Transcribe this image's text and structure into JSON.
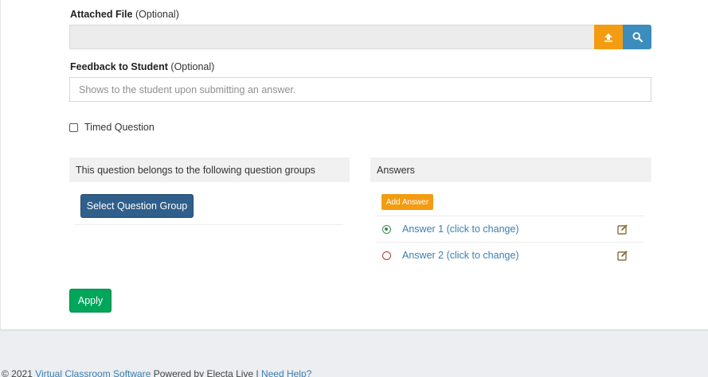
{
  "attached_file": {
    "label": "Attached File",
    "optional": "(Optional)",
    "upload_icon": "upload-icon",
    "search_icon": "search-icon"
  },
  "feedback": {
    "label": "Feedback to Student",
    "optional": "(Optional)",
    "placeholder": "Shows to the student upon submitting an answer."
  },
  "timed_question": {
    "label": "Timed Question",
    "checked": false
  },
  "question_groups": {
    "heading": "This question belongs to the following question groups",
    "select_button": "Select Question Group"
  },
  "answers": {
    "heading": "Answers",
    "add_button": "Add Answer",
    "items": [
      {
        "label": "Answer 1 (click to change)",
        "status": "correct",
        "edit_icon": "edit-icon"
      },
      {
        "label": "Answer 2 (click to change)",
        "status": "incorrect",
        "edit_icon": "edit-icon"
      }
    ]
  },
  "apply_button": "Apply",
  "footer": {
    "copyright": "© 2021",
    "link1": "Virtual Classroom Software",
    "powered": "Powered by Electa Live |",
    "link2": "Need Help?"
  },
  "colors": {
    "upload": "#f39c12",
    "search": "#3c8dbc",
    "select_group": "#2f5f8a",
    "apply": "#00a65a",
    "link": "#3c7fb1",
    "correct": "#3c8d4f",
    "incorrect": "#b03a2e",
    "edit_icon": "#8a6d3b"
  }
}
